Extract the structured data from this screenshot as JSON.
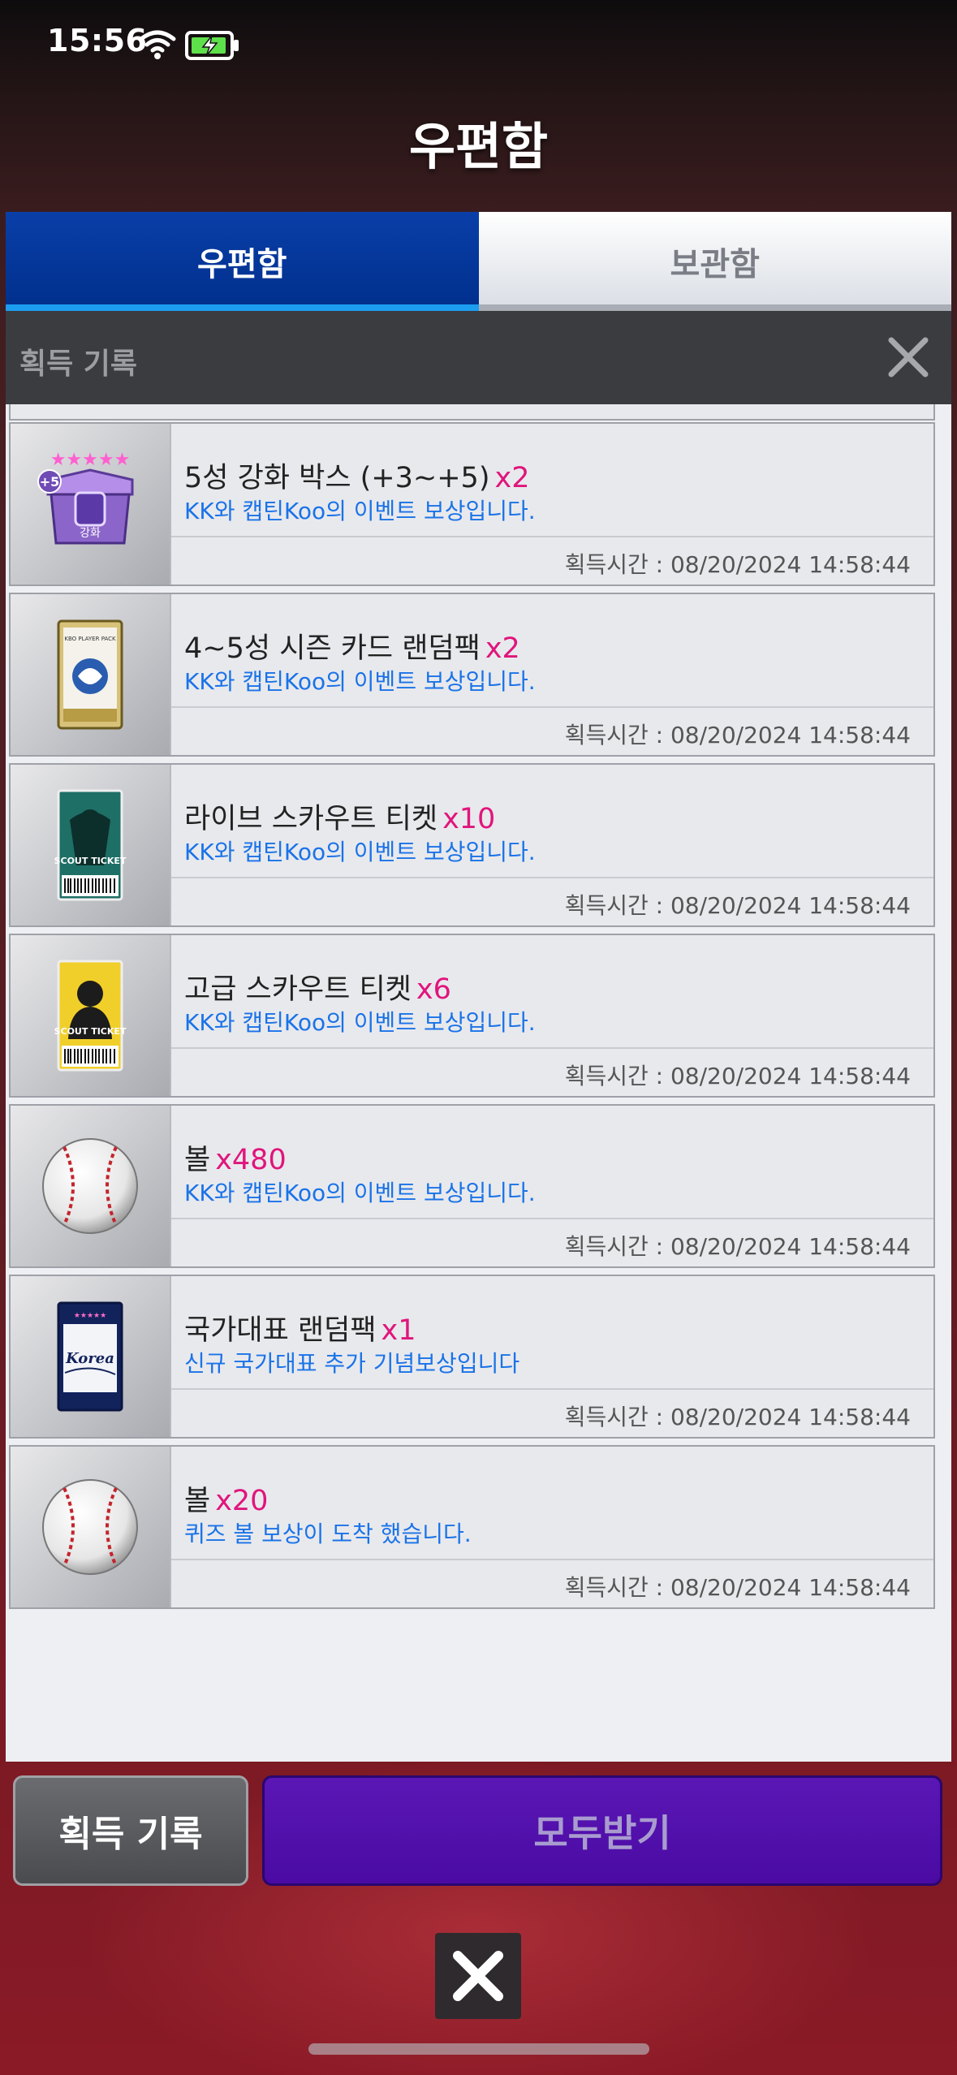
{
  "status_bar": {
    "time": "15:56"
  },
  "header": {
    "title": "우편함"
  },
  "tabs": [
    {
      "label": "우편함",
      "active": true
    },
    {
      "label": "보관함",
      "active": false
    }
  ],
  "panel": {
    "title": "획득 기록"
  },
  "items": [
    {
      "name": "5성 강화 박스 (+3~+5)",
      "qty": "x2",
      "desc": "KK와 캡틴Koo의 이벤트 보상입니다.",
      "time": "획득시간 : 08/20/2024 14:58:44",
      "icon": "upgrade-box-icon"
    },
    {
      "name": "4~5성 시즌 카드 랜덤팩",
      "qty": "x2",
      "desc": "KK와 캡틴Koo의 이벤트 보상입니다.",
      "time": "획득시간 : 08/20/2024 14:58:44",
      "icon": "card-pack-icon"
    },
    {
      "name": "라이브 스카우트 티켓",
      "qty": "x10",
      "desc": "KK와 캡틴Koo의 이벤트 보상입니다.",
      "time": "획득시간 : 08/20/2024 14:58:44",
      "icon": "live-scout-ticket-icon"
    },
    {
      "name": "고급 스카우트 티켓",
      "qty": "x6",
      "desc": "KK와 캡틴Koo의 이벤트 보상입니다.",
      "time": "획득시간 : 08/20/2024 14:58:44",
      "icon": "premium-scout-ticket-icon"
    },
    {
      "name": "볼",
      "qty": "x480",
      "desc": "KK와 캡틴Koo의 이벤트 보상입니다.",
      "time": "획득시간 : 08/20/2024 14:58:44",
      "icon": "baseball-icon"
    },
    {
      "name": "국가대표 랜덤팩",
      "qty": "x1",
      "desc": "신규 국가대표 추가 기념보상입니다",
      "time": "획득시간 : 08/20/2024 14:58:44",
      "icon": "national-team-pack-icon"
    },
    {
      "name": "볼",
      "qty": "x20",
      "desc": "퀴즈 볼 보상이 도착 했습니다.",
      "time": "획득시간 : 08/20/2024 14:58:44",
      "icon": "baseball-icon"
    }
  ],
  "pack_labels": {
    "upgrade_stars": "★★★★★",
    "upgrade_plus": "+5",
    "upgrade_text": "강화",
    "card_pack_text": "KBO PLAYER PACK",
    "scout_text": "SCOUT TICKET",
    "korea_text": "Korea"
  },
  "buttons": {
    "history": "획득 기록",
    "claim_all": "모두받기"
  },
  "colors": {
    "tab_active": "#0a3fa8",
    "qty": "#e0157c",
    "desc": "#1a73e8",
    "claim_button": "#5b17b5"
  }
}
